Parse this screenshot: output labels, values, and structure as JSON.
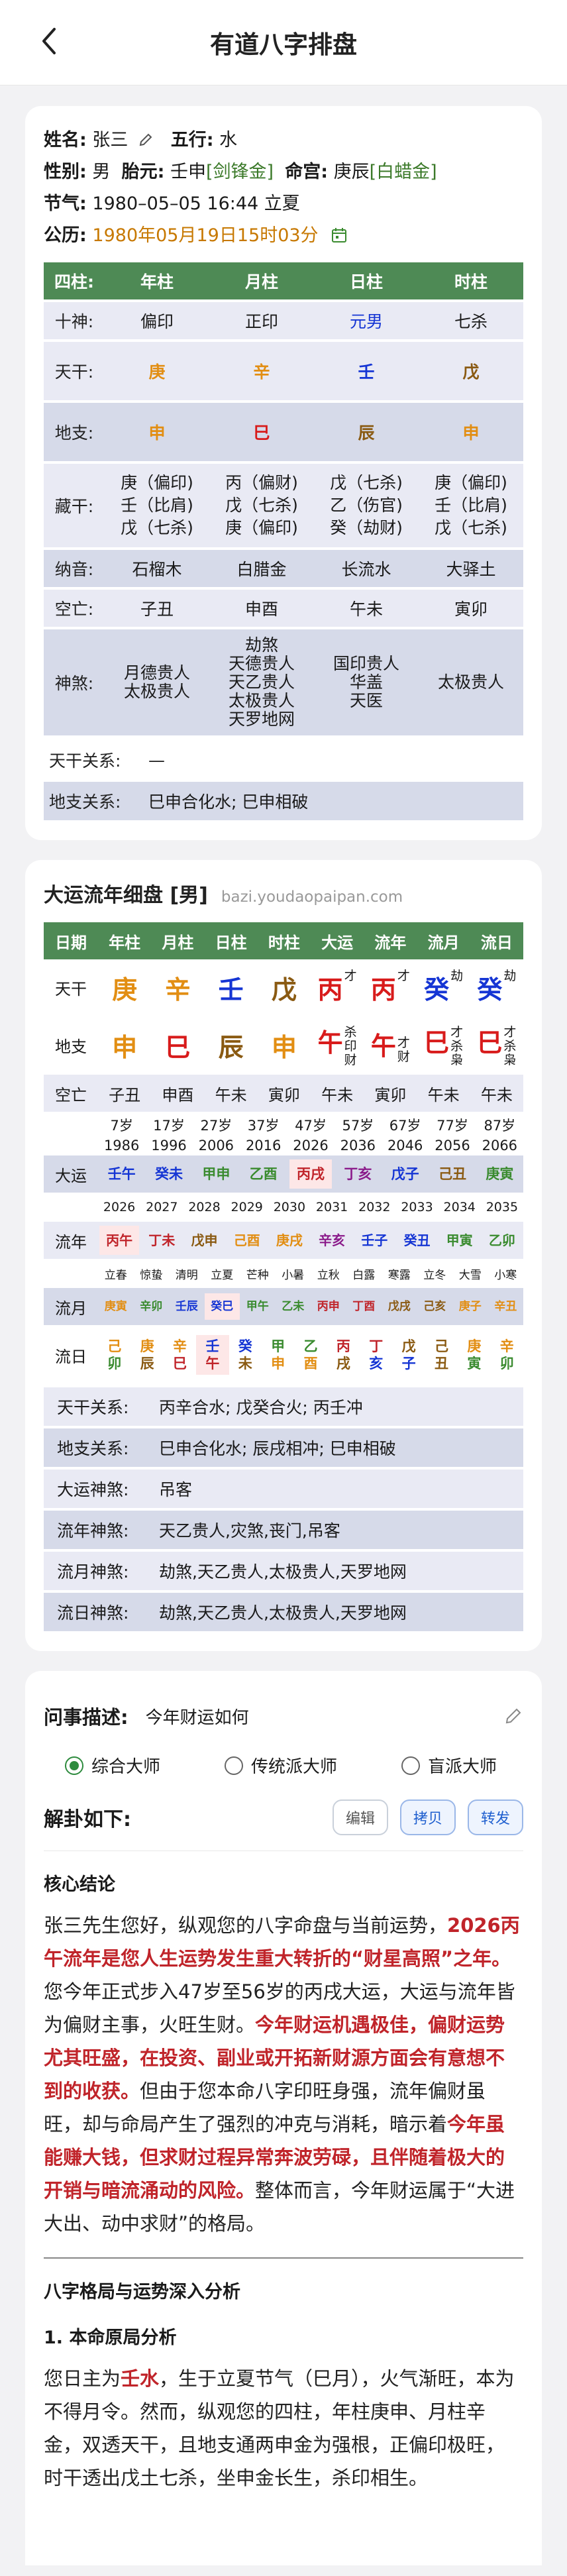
{
  "header": {
    "title": "有道八字排盘"
  },
  "info": {
    "name_label": "姓名:",
    "name": "张三",
    "wuxing_label": "五行:",
    "wuxing": "水",
    "gender_label": "性别:",
    "gender": "男",
    "taiyuan_label": "胎元:",
    "taiyuan": "壬申",
    "taiyuan_nayin": "[剑锋金]",
    "minggong_label": "命宫:",
    "minggong": "庚辰",
    "minggong_nayin": "[白蜡金]",
    "jieqi_label": "节气:",
    "jieqi": "1980–05–05 16:44 立夏",
    "gongli_label": "公历:",
    "gongli": "1980年05月19日15时03分"
  },
  "pillars": {
    "headers": [
      "四柱:",
      "年柱",
      "月柱",
      "日柱",
      "时柱"
    ],
    "shishen": {
      "label": "十神:",
      "values": [
        "偏印",
        "正印",
        "元男",
        "七杀"
      ]
    },
    "tiangan": {
      "label": "天干:",
      "values": [
        "庚",
        "辛",
        "壬",
        "戊"
      ]
    },
    "dizhi": {
      "label": "地支:",
      "values": [
        "申",
        "巳",
        "辰",
        "申"
      ]
    },
    "canggan": {
      "label": "藏干:",
      "values": [
        [
          "庚（偏印)",
          "壬（比肩)",
          "戊（七杀)"
        ],
        [
          "丙（偏财)",
          "戊（七杀)",
          "庚（偏印)"
        ],
        [
          "戊（七杀)",
          "乙（伤官)",
          "癸（劫财)"
        ],
        [
          "庚（偏印)",
          "壬（比肩)",
          "戊（七杀)"
        ]
      ]
    },
    "nayin": {
      "label": "纳音:",
      "values": [
        "石榴木",
        "白腊金",
        "长流水",
        "大驿土"
      ]
    },
    "kongwang": {
      "label": "空亡:",
      "values": [
        "子丑",
        "申酉",
        "午未",
        "寅卯"
      ]
    },
    "shensha": {
      "label": "神煞:",
      "values": [
        [
          "月德贵人",
          "太极贵人"
        ],
        [
          "劫煞",
          "天德贵人",
          "天乙贵人",
          "太极贵人",
          "天罗地网"
        ],
        [
          "国印贵人",
          "华盖",
          "天医"
        ],
        [
          "太极贵人"
        ]
      ]
    },
    "tiangan_rel": {
      "label": "天干关系:",
      "value": "—"
    },
    "dizhi_rel": {
      "label": "地支关系:",
      "value": "巳申合化水; 巳申相破"
    }
  },
  "dayun": {
    "title": "大运流年细盘 [男]",
    "url": "bazi.youdaopaipan.com",
    "headers": [
      "日期",
      "年柱",
      "月柱",
      "日柱",
      "时柱",
      "大运",
      "流年",
      "流月",
      "流日"
    ],
    "tiangan": {
      "label": "天干",
      "values": [
        "庚",
        "辛",
        "壬",
        "戊",
        "丙",
        "丙",
        "癸",
        "癸"
      ],
      "sups": [
        "",
        "",
        "",
        "",
        "才",
        "才",
        "劫",
        "劫"
      ]
    },
    "dizhi": {
      "label": "地支",
      "values": [
        "申",
        "巳",
        "辰",
        "申",
        "午",
        "午",
        "巳",
        "巳"
      ],
      "sups": [
        [
          "",
          ""
        ],
        [
          "",
          ""
        ],
        [
          "",
          ""
        ],
        [
          "",
          ""
        ],
        [
          "杀",
          "印",
          "财"
        ],
        [
          "才",
          "财"
        ],
        [
          "才",
          "杀",
          "枭"
        ],
        [
          "才",
          "杀",
          "枭"
        ]
      ]
    },
    "kongwang": {
      "label": "空亡",
      "values": [
        "子丑",
        "申酉",
        "午未",
        "寅卯",
        "午未",
        "寅卯",
        "午未",
        "午未"
      ]
    },
    "ages": [
      "7岁",
      "17岁",
      "27岁",
      "37岁",
      "47岁",
      "57岁",
      "67岁",
      "77岁",
      "87岁"
    ],
    "years": [
      "1986",
      "1996",
      "2006",
      "2016",
      "2026",
      "2036",
      "2046",
      "2056",
      "2066"
    ],
    "dayun_label": "大运",
    "dayun_gz": [
      "壬午",
      "癸未",
      "甲申",
      "乙酉",
      "丙戌",
      "丁亥",
      "戊子",
      "己丑",
      "庚寅"
    ],
    "liunian_years": [
      "2026",
      "2027",
      "2028",
      "2029",
      "2030",
      "2031",
      "2032",
      "2033",
      "2034",
      "2035"
    ],
    "liunian_label": "流年",
    "liunian_gz": [
      "丙午",
      "丁未",
      "戊申",
      "己酉",
      "庚戌",
      "辛亥",
      "壬子",
      "癸丑",
      "甲寅",
      "乙卯"
    ],
    "jieqi": [
      "立春",
      "惊蛰",
      "清明",
      "立夏",
      "芒种",
      "小暑",
      "立秋",
      "白露",
      "寒露",
      "立冬",
      "大雪",
      "小寒"
    ],
    "liuyue_label": "流月",
    "liuyue_gz": [
      "庚寅",
      "辛卯",
      "壬辰",
      "癸巳",
      "甲午",
      "乙未",
      "丙申",
      "丁酉",
      "戊戌",
      "己亥",
      "庚子",
      "辛丑"
    ],
    "liuri_label": "流日",
    "liuri_gz": [
      [
        "己",
        "卯"
      ],
      [
        "庚",
        "辰"
      ],
      [
        "辛",
        "巳"
      ],
      [
        "壬",
        "午"
      ],
      [
        "癸",
        "未"
      ],
      [
        "甲",
        "申"
      ],
      [
        "乙",
        "酉"
      ],
      [
        "丙",
        "戌"
      ],
      [
        "丁",
        "亥"
      ],
      [
        "戊",
        "子"
      ],
      [
        "己",
        "丑"
      ],
      [
        "庚",
        "寅"
      ],
      [
        "辛",
        "卯"
      ]
    ],
    "rels": [
      {
        "label": "天干关系:",
        "value": "丙辛合水; 戊癸合火; 丙壬冲"
      },
      {
        "label": "地支关系:",
        "value": "巳申合化水; 辰戌相冲; 巳申相破"
      },
      {
        "label": "大运神煞:",
        "value": "吊客"
      },
      {
        "label": "流年神煞:",
        "value": "天乙贵人,灾煞,丧门,吊客"
      },
      {
        "label": "流月神煞:",
        "value": "劫煞,天乙贵人,太极贵人,天罗地网"
      },
      {
        "label": "流日神煞:",
        "value": "劫煞,天乙贵人,太极贵人,天罗地网"
      }
    ]
  },
  "question": {
    "label": "问事描述:",
    "value": "今年财运如何",
    "options": [
      "综合大师",
      "传统派大师",
      "盲派大师"
    ],
    "selected": 0,
    "answer_title": "解卦如下:",
    "buttons": [
      "编辑",
      "拷贝",
      "转发"
    ],
    "section1": "核心结论",
    "p1": {
      "a": "张三先生您好，纵观您的八字命盘与当前运势，",
      "b": "2026丙午流年是您人生运势发生重大转折的“财星高照”之年。",
      "c": "您今年正式步入47岁至56岁的丙戌大运，大运与流年皆为偏财主事，火旺生财。",
      "d": "今年财运机遇极佳，偏财运势尤其旺盛，在投资、副业或开拓新财源方面会有意想不到的收获。",
      "e": "但由于您本命八字印旺身强，流年偏财虽旺，却与命局产生了强烈的冲克与消耗，暗示着",
      "f": "今年虽能赚大钱，但求财过程异常奔波劳碌，且伴随着极大的开销与暗流涌动的风险。",
      "g": "整体而言，今年财运属于“大进大出、动中求财”的格局。"
    },
    "section2": "八字格局与运势深入分析",
    "section3": "1. 本命原局分析",
    "p2": {
      "a": "您日主为",
      "b": "壬水",
      "c": "，生于立夏节气（巳月），火气渐旺，本为不得月令。然而，纵观您的四柱，年柱庚申、月柱辛金，双透天干，且地支通两申金为强根，正偏印极旺，时干透出戊土七杀，坐申金长生，杀印相生。"
    }
  },
  "colors": {
    "header_green": "#4e8a55",
    "row_light": "#e9eaf4",
    "row_mid": "#d6dae9",
    "accent_red": "#c0242a"
  }
}
